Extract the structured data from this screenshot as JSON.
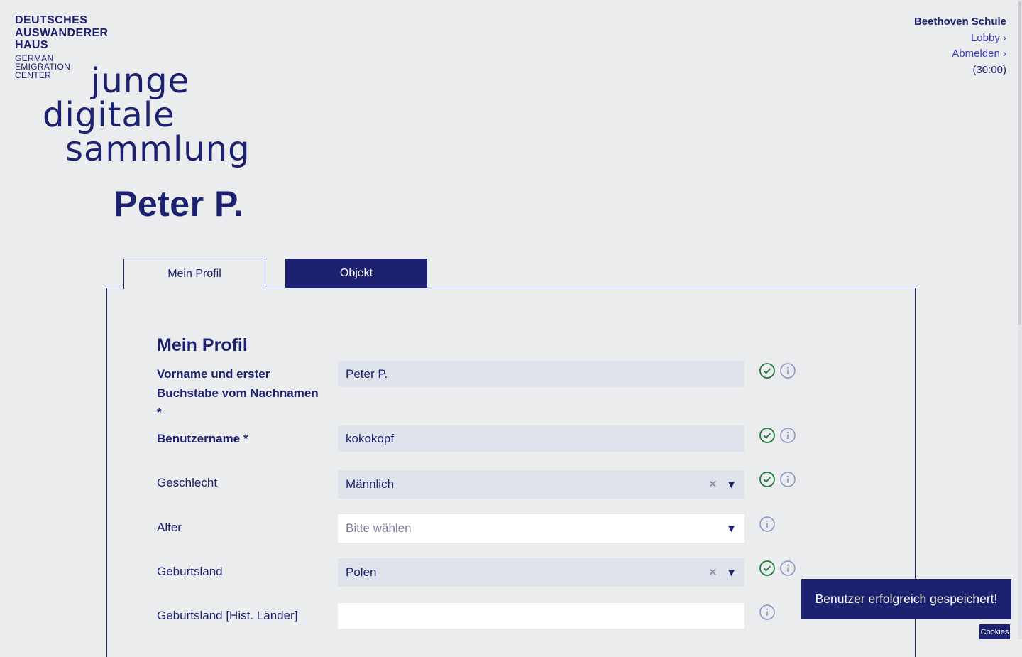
{
  "brand": {
    "lines": [
      "DEUTSCHES",
      "AUSWANDERER",
      "HAUS"
    ],
    "sub": [
      "GERMAN",
      "EMIGRATION",
      "CENTER"
    ]
  },
  "logo": {
    "lines": [
      "junge",
      "digitale",
      "sammlung"
    ]
  },
  "user": {
    "display_name": "Peter P."
  },
  "topnav": {
    "school": "Beethoven Schule",
    "lobby": "Lobby ›",
    "logout": "Abmelden ›",
    "timer": "(30:00)"
  },
  "tabs": [
    {
      "label": "Mein Profil",
      "active": true
    },
    {
      "label": "Objekt",
      "active": false
    }
  ],
  "form": {
    "title": "Mein Profil",
    "fields": [
      {
        "label": "Vorname und erster Buchstabe vom Nachnamen *",
        "value": "Peter P.",
        "type": "text",
        "valid": true
      },
      {
        "label": "Benutzername *",
        "value": "kokokopf",
        "type": "text",
        "valid": true
      },
      {
        "label": "Geschlecht",
        "value": "Männlich",
        "type": "select",
        "valid": true,
        "clearable": true
      },
      {
        "label": "Alter",
        "value": "",
        "placeholder": "Bitte wählen",
        "type": "select",
        "valid": false
      },
      {
        "label": "Geburtsland",
        "value": "Polen",
        "type": "select",
        "valid": true,
        "clearable": true
      },
      {
        "label": "Geburtsland [Hist. Länder]",
        "value": "",
        "type": "text",
        "valid": false
      }
    ],
    "clear_symbol": "×",
    "caret_symbol": "▼"
  },
  "toast": {
    "message": "Benutzer erfolgreich gespeichert!"
  },
  "cookies": {
    "label": "Cookies"
  },
  "colors": {
    "primary": "#1c2170",
    "link": "#3a40b3",
    "valid": "#1e7a3c",
    "info": "#8b90c6",
    "background": "#ebecee",
    "field": "#dfe3ec"
  },
  "icons": {
    "valid": "check-circle-icon",
    "info": "info-circle-icon"
  }
}
